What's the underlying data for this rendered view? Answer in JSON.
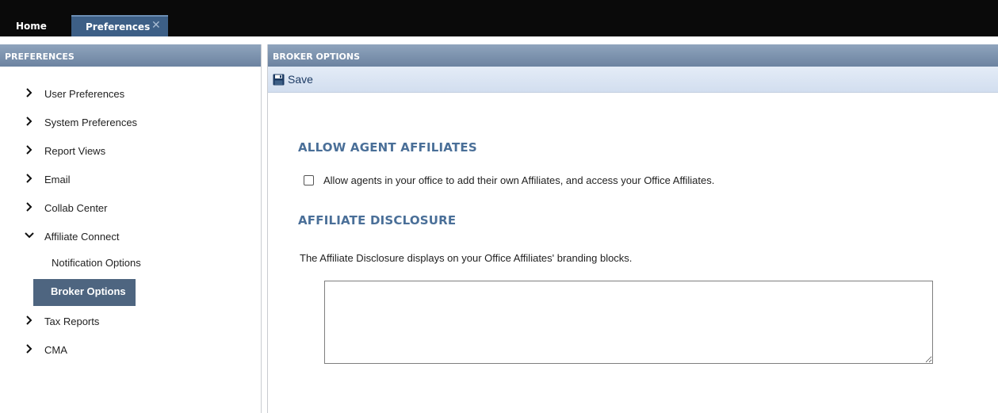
{
  "tabs": {
    "home": "Home",
    "preferences": "Preferences",
    "close_glyph": "✕"
  },
  "left_panel": {
    "title": "PREFERENCES",
    "items": [
      {
        "label": "User Preferences",
        "expanded": false
      },
      {
        "label": "System Preferences",
        "expanded": false
      },
      {
        "label": "Report Views",
        "expanded": false
      },
      {
        "label": "Email",
        "expanded": false
      },
      {
        "label": "Collab Center",
        "expanded": false
      },
      {
        "label": "Affiliate Connect",
        "expanded": true
      },
      {
        "label": "Tax Reports",
        "expanded": false
      },
      {
        "label": "CMA",
        "expanded": false
      }
    ],
    "sub_items": [
      {
        "label": "Notification Options",
        "active": false
      },
      {
        "label": "Broker Options",
        "active": true
      }
    ]
  },
  "right_panel": {
    "title": "BROKER OPTIONS",
    "toolbar": {
      "save_label": "Save",
      "save_icon": "floppy-disk-icon"
    },
    "allow_section": {
      "heading": "ALLOW AGENT AFFILIATES",
      "checkbox_label": "Allow agents in your office to add their own Affiliates, and access your Office Affiliates.",
      "checked": false
    },
    "disclosure_section": {
      "heading": "AFFILIATE DISCLOSURE",
      "description": "The Affiliate Disclosure displays on your Office Affiliates' branding blocks.",
      "textarea_value": ""
    }
  },
  "colors": {
    "topbar": "#0a0a0a",
    "active_tab": "#3d5f86",
    "panel_header": "#7b91ad",
    "active_nav": "#4e6580",
    "section_heading": "#4a6f98"
  }
}
